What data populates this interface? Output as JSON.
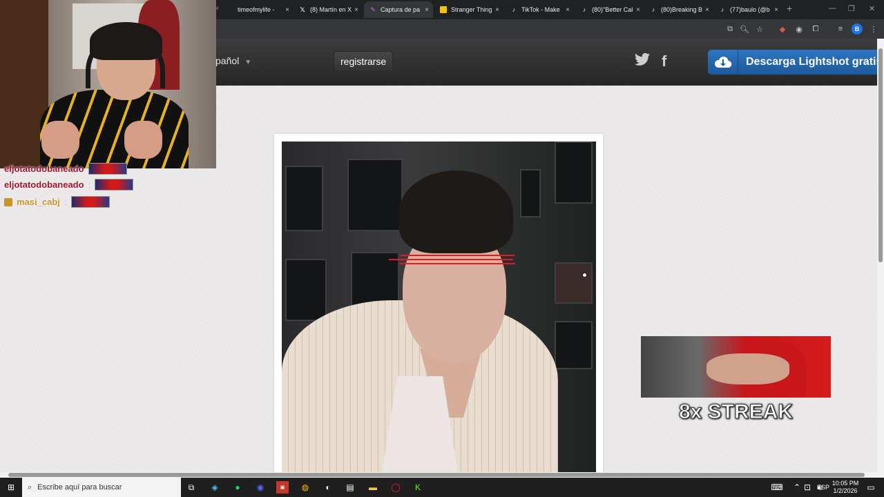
{
  "browser": {
    "tabs": [
      {
        "label": "timeofmylife -",
        "icon": "page-icon",
        "active": false
      },
      {
        "label": "(8) Martín en X",
        "icon": "x-logo-icon",
        "active": false
      },
      {
        "label": "Captura de pa",
        "icon": "lightshot-feather-icon",
        "active": true
      },
      {
        "label": "Stranger Thing",
        "icon": "yellow-tag-icon",
        "active": false
      },
      {
        "label": "TikTok - Make",
        "icon": "tiktok-icon",
        "active": false
      },
      {
        "label": "(80)\"Better Cal",
        "icon": "tiktok-icon",
        "active": false
      },
      {
        "label": "(80)Breaking B",
        "icon": "tiktok-icon",
        "active": false
      },
      {
        "label": "(77)baulo (@b",
        "icon": "tiktok-icon",
        "active": false
      }
    ],
    "new_tab": "+",
    "tab_close": "×",
    "profile_initial": "B"
  },
  "site": {
    "language": "español",
    "language_visible": "pañol",
    "register": "registrarse",
    "download": "Descarga Lightshot gratis",
    "download_visible": "Descarga Lightshot gratis",
    "twitter_glyph": "🐦",
    "facebook_glyph": "f"
  },
  "chat": [
    {
      "user": "eljotatodobaneado",
      "partial": true
    },
    {
      "user": "eljotatodobaneado",
      "partial": false
    },
    {
      "user": "masi_cabj",
      "partial": false
    }
  ],
  "overlay": {
    "streak": "8x STREAK"
  },
  "taskbar": {
    "search_placeholder": "Escribe aquí para buscar",
    "language": "ESP",
    "time": "10:05 PM",
    "date": "1/2/2026"
  },
  "colors": {
    "accent_blue": "#2d75c0",
    "chat_name": "#a2112a",
    "chat_name_gold": "#c9922a",
    "red_line": "#e01b24"
  }
}
